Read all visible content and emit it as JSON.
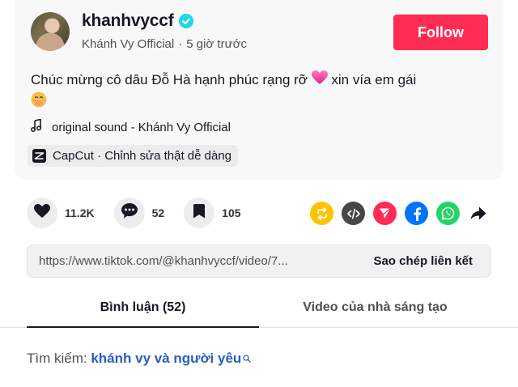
{
  "author": {
    "username": "khanhvyccf",
    "display_name": "Khánh Vy Official",
    "separator": "·",
    "posted_ago": "5 giờ trước",
    "follow_label": "Follow"
  },
  "caption": {
    "text_part1": "Chúc mừng cô dâu Đỗ Hà hạnh phúc rạng rỡ ",
    "text_part2": " xin vía em gái"
  },
  "sound": {
    "label": "original sound - Khánh Vy Official"
  },
  "capcut": {
    "label": "CapCut · Chỉnh sửa thật dễ dàng"
  },
  "actions": {
    "likes": "11.2K",
    "comments": "52",
    "saves": "105"
  },
  "share": {
    "icons": [
      "repost-icon",
      "embed-icon",
      "send-to-friends-icon",
      "facebook-icon",
      "whatsapp-icon",
      "share-arrow-icon"
    ]
  },
  "link": {
    "url": "https://www.tiktok.com/@khanhvyccf/video/7...",
    "copy_label": "Sao chép liên kết"
  },
  "tabs": {
    "comments": "Bình luận (52)",
    "creator_videos": "Video của nhà sáng tạo"
  },
  "search_suggestion": {
    "prefix": "Tìm kiếm:",
    "term": "khánh vy và người yêu"
  },
  "colors": {
    "follow_bg": "#fe2c55",
    "verified": "#20d5ec",
    "search_term": "#2b5db9",
    "repost": "#ffc300",
    "embed": "#474747",
    "send": "#fe2c55",
    "facebook": "#0075fa",
    "whatsapp": "#25d366"
  }
}
